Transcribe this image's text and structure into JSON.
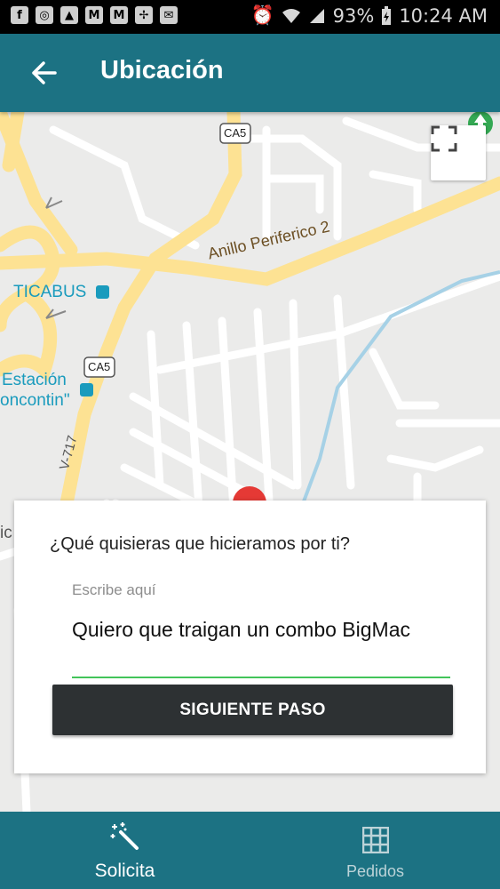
{
  "status_bar": {
    "battery": "93%",
    "time": "10:24 AM"
  },
  "app_bar": {
    "title": "Ubicación"
  },
  "map": {
    "labels": {
      "road_ca5_top": "CA5",
      "road_ca5_mid": "CA5",
      "ring_road": "Anillo Periferico 2",
      "ticabus": "TICABUS",
      "station_line1": "Estación",
      "station_line2": "oncontin\"",
      "road_v717": "V-717",
      "edge_partial": "ic"
    },
    "colors": {
      "background": "#ebebea",
      "major_road": "#fde293",
      "transit": "#1a9bbd",
      "marker": "#e53935"
    }
  },
  "card": {
    "question": "¿Qué quisieras que hicieramos por ti?",
    "input_label": "Escribe aquí",
    "input_value": "Quiero que traigan un combo BigMac",
    "next_button": "SIGUIENTE PASO"
  },
  "bottom_nav": {
    "items": [
      {
        "label": "Solicita",
        "icon": "magic-wand-icon",
        "active": true
      },
      {
        "label": "Pedidos",
        "icon": "grid-icon",
        "active": false
      }
    ]
  },
  "colors": {
    "primary": "#1c7283",
    "button_dark": "#2d3133",
    "input_underline": "#43c45a"
  }
}
